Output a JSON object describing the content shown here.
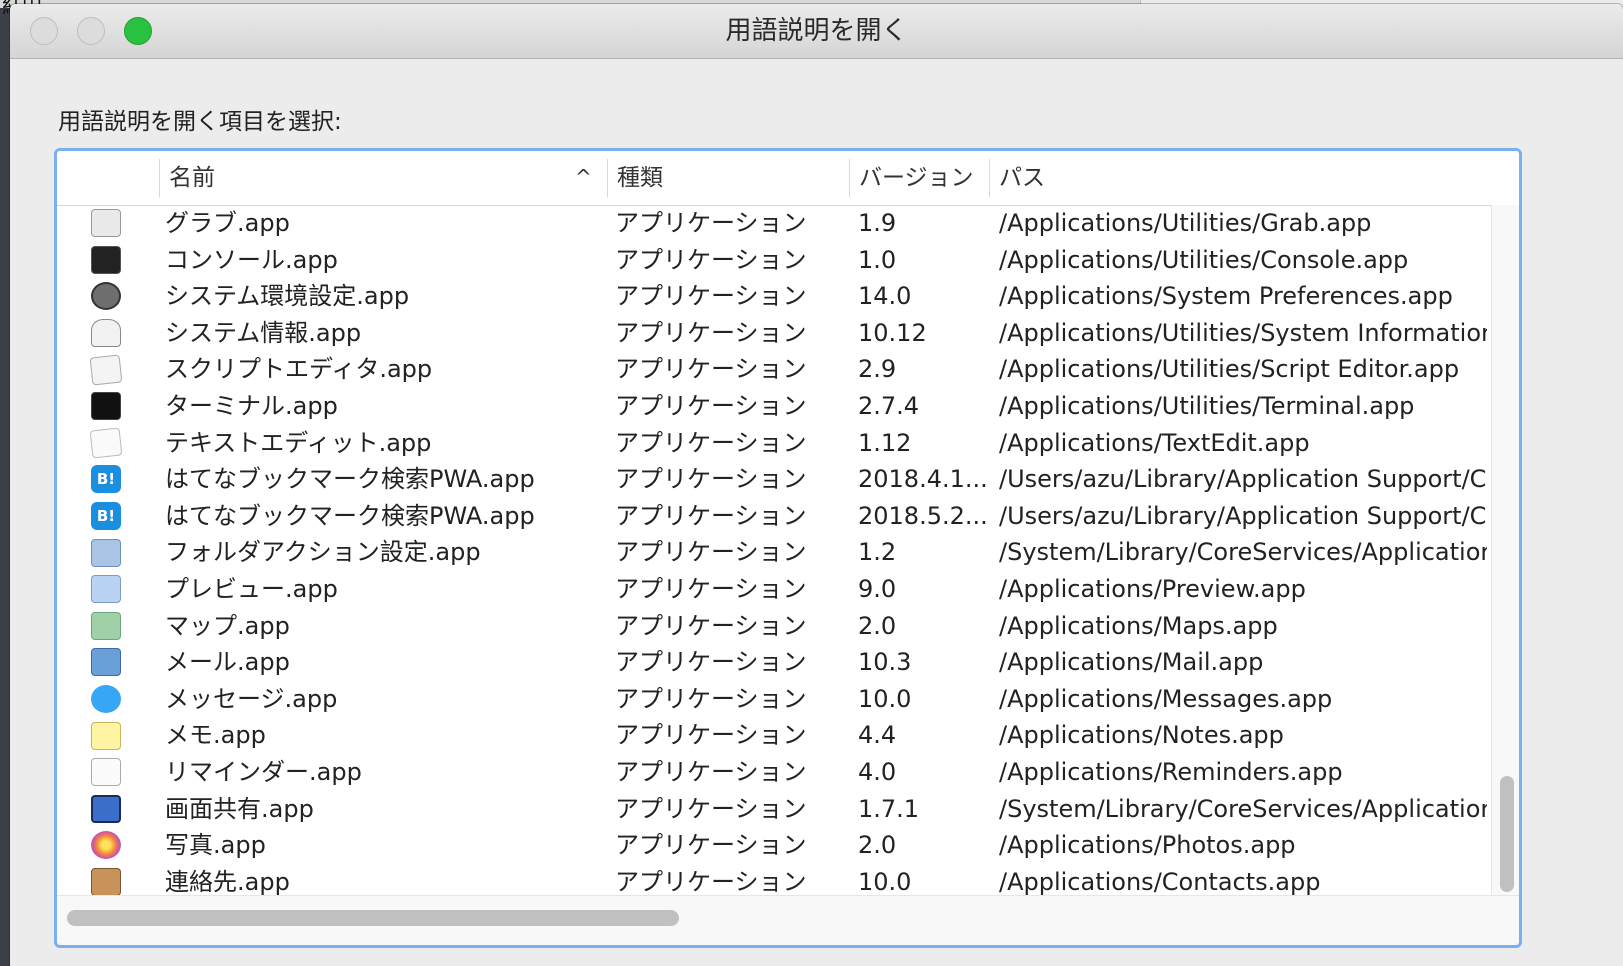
{
  "window": {
    "title": "用語説明を開く"
  },
  "prompt": "用語説明を開く項目を選択:",
  "table": {
    "columns": {
      "name": "名前",
      "kind": "種類",
      "version": "バージョン",
      "path": "パス"
    },
    "sort_indicator": "^",
    "rows": [
      {
        "icon": "grab-icon",
        "name": "グラブ.app",
        "kind": "アプリケーション",
        "version": "1.9",
        "path": "/Applications/Utilities/Grab.app"
      },
      {
        "icon": "console-icon",
        "name": "コンソール.app",
        "kind": "アプリケーション",
        "version": "1.0",
        "path": "/Applications/Utilities/Console.app"
      },
      {
        "icon": "system-preferences-icon",
        "name": "システム環境設定.app",
        "kind": "アプリケーション",
        "version": "14.0",
        "path": "/Applications/System Preferences.app"
      },
      {
        "icon": "system-information-icon",
        "name": "システム情報.app",
        "kind": "アプリケーション",
        "version": "10.12",
        "path": "/Applications/Utilities/System Informatior"
      },
      {
        "icon": "script-editor-icon",
        "name": "スクリプトエディタ.app",
        "kind": "アプリケーション",
        "version": "2.9",
        "path": "/Applications/Utilities/Script Editor.app"
      },
      {
        "icon": "terminal-icon",
        "name": "ターミナル.app",
        "kind": "アプリケーション",
        "version": "2.7.4",
        "path": "/Applications/Utilities/Terminal.app"
      },
      {
        "icon": "textedit-icon",
        "name": "テキストエディット.app",
        "kind": "アプリケーション",
        "version": "1.12",
        "path": "/Applications/TextEdit.app"
      },
      {
        "icon": "hatena-bookmark-icon",
        "icon_text": "B!",
        "name": "はてなブックマーク検索PWA.app",
        "kind": "アプリケーション",
        "version": "2018.4.1...",
        "path": "/Users/azu/Library/Application Support/C"
      },
      {
        "icon": "hatena-bookmark-icon",
        "icon_text": "B!",
        "name": "はてなブックマーク検索PWA.app",
        "kind": "アプリケーション",
        "version": "2018.5.2...",
        "path": "/Users/azu/Library/Application Support/C"
      },
      {
        "icon": "folder-actions-icon",
        "name": "フォルダアクション設定.app",
        "kind": "アプリケーション",
        "version": "1.2",
        "path": "/System/Library/CoreServices/Applicatior"
      },
      {
        "icon": "preview-icon",
        "name": "プレビュー.app",
        "kind": "アプリケーション",
        "version": "9.0",
        "path": "/Applications/Preview.app"
      },
      {
        "icon": "maps-icon",
        "name": "マップ.app",
        "kind": "アプリケーション",
        "version": "2.0",
        "path": "/Applications/Maps.app"
      },
      {
        "icon": "mail-icon",
        "name": "メール.app",
        "kind": "アプリケーション",
        "version": "10.3",
        "path": "/Applications/Mail.app"
      },
      {
        "icon": "messages-icon",
        "name": "メッセージ.app",
        "kind": "アプリケーション",
        "version": "10.0",
        "path": "/Applications/Messages.app"
      },
      {
        "icon": "notes-icon",
        "name": "メモ.app",
        "kind": "アプリケーション",
        "version": "4.4",
        "path": "/Applications/Notes.app"
      },
      {
        "icon": "reminders-icon",
        "name": "リマインダー.app",
        "kind": "アプリケーション",
        "version": "4.0",
        "path": "/Applications/Reminders.app"
      },
      {
        "icon": "screen-sharing-icon",
        "name": "画面共有.app",
        "kind": "アプリケーション",
        "version": "1.7.1",
        "path": "/System/Library/CoreServices/Applicatior"
      },
      {
        "icon": "photos-icon",
        "name": "写真.app",
        "kind": "アプリケーション",
        "version": "2.0",
        "path": "/Applications/Photos.app"
      },
      {
        "icon": "contacts-icon",
        "name": "連絡先.app",
        "kind": "アプリケーション",
        "version": "10.0",
        "path": "/Applications/Contacts.app"
      }
    ]
  },
  "colors": {
    "accent_focus": "#7ab0ef",
    "zoom_button": "#29c240"
  }
}
